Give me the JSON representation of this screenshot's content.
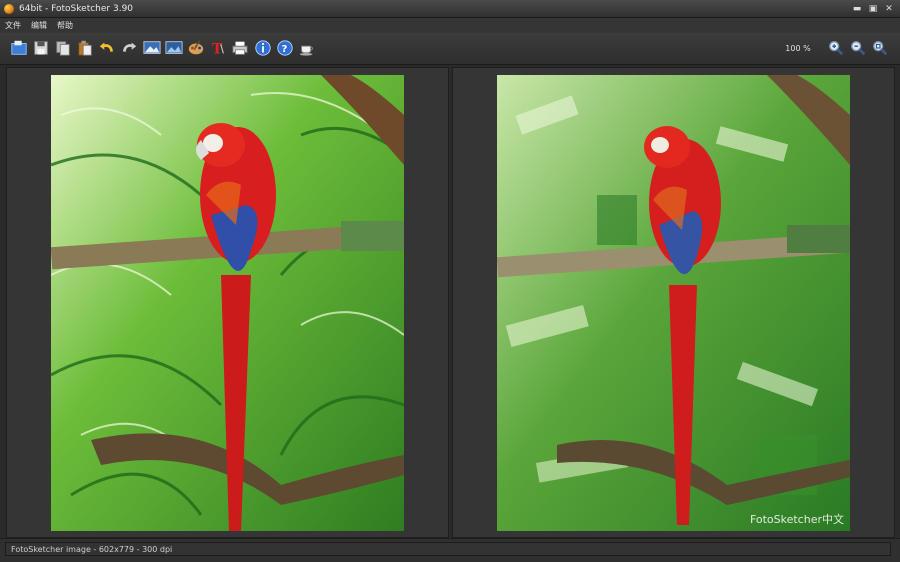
{
  "window": {
    "title": "64bit - FotoSketcher 3.90",
    "minimize_glyph": "▬",
    "maximize_glyph": "▣",
    "close_glyph": "✕"
  },
  "menu": {
    "items": [
      "文件",
      "编辑",
      "帮助"
    ]
  },
  "toolbar": {
    "buttons": [
      {
        "name": "open-icon"
      },
      {
        "name": "save-icon"
      },
      {
        "name": "copy-icon"
      },
      {
        "name": "paste-icon"
      },
      {
        "name": "undo-icon"
      },
      {
        "name": "redo-icon"
      },
      {
        "name": "original-image-icon"
      },
      {
        "name": "processed-image-icon"
      },
      {
        "name": "palette-icon"
      },
      {
        "name": "text-icon"
      },
      {
        "name": "print-icon"
      },
      {
        "name": "info-icon"
      },
      {
        "name": "help-icon"
      },
      {
        "name": "coffee-icon"
      },
      {
        "name": "zoom-in-icon"
      },
      {
        "name": "zoom-out-icon"
      },
      {
        "name": "zoom-fit-icon"
      }
    ],
    "zoom_level": "100 %"
  },
  "panes": {
    "right": {
      "watermark": "FotoSketcher中文"
    }
  },
  "status": {
    "text": "FotoSketcher image - 602x779 - 300 dpi"
  },
  "colors": {
    "accent_blue": "#2f6fd6",
    "parrot_red": "#d81e1e",
    "foliage_green": "#3f9e2e"
  }
}
